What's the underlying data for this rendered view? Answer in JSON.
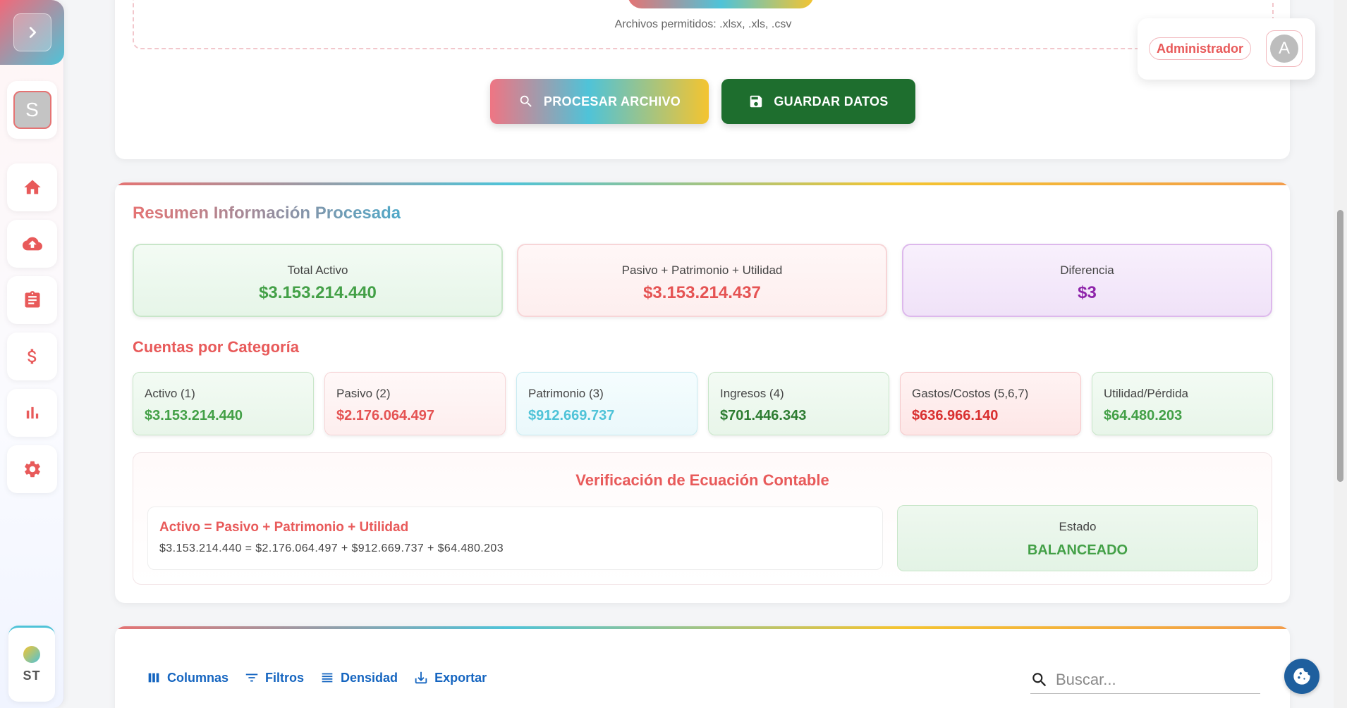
{
  "sidebar": {
    "toggle_icon": "chevron-right-icon",
    "user_initial": "S",
    "nav": [
      {
        "icon": "home-icon"
      },
      {
        "icon": "cloud-upload-icon"
      },
      {
        "icon": "clipboard-icon"
      },
      {
        "icon": "dollar-icon"
      },
      {
        "icon": "bar-chart-icon"
      },
      {
        "icon": "gear-icon"
      }
    ],
    "theme_label": "ST"
  },
  "upload": {
    "allowed_text": "Archivos permitidos: .xlsx, .xls, .csv",
    "process_label": "PROCESAR ARCHIVO",
    "save_label": "GUARDAR DATOS"
  },
  "user": {
    "role": "Administrador",
    "initial": "A"
  },
  "summary": {
    "title": "Resumen Información Procesada",
    "total_activo_label": "Total Activo",
    "total_activo_value": "$3.153.214.440",
    "pasivo_label": "Pasivo + Patrimonio + Utilidad",
    "pasivo_value": "$3.153.214.437",
    "diferencia_label": "Diferencia",
    "diferencia_value": "$3",
    "categories_title": "Cuentas por Categoría",
    "categories": [
      {
        "label": "Activo (1)",
        "value": "$3.153.214.440"
      },
      {
        "label": "Pasivo (2)",
        "value": "$2.176.064.497"
      },
      {
        "label": "Patrimonio (3)",
        "value": "$912.669.737"
      },
      {
        "label": "Ingresos (4)",
        "value": "$701.446.343"
      },
      {
        "label": "Gastos/Costos (5,6,7)",
        "value": "$636.966.140"
      },
      {
        "label": "Utilidad/Pérdida",
        "value": "$64.480.203"
      }
    ],
    "verification_title": "Verificación de Ecuación Contable",
    "equation_title": "Activo = Pasivo + Patrimonio + Utilidad",
    "equation_line": "$3.153.214.440 = $2.176.064.497 + $912.669.737 + $64.480.203",
    "estado_label": "Estado",
    "estado_value": "BALANCEADO"
  },
  "table_toolbar": {
    "columns_label": "Columnas",
    "filters_label": "Filtros",
    "density_label": "Densidad",
    "export_label": "Exportar",
    "search_placeholder": "Buscar..."
  },
  "colors": {
    "accent_red": "#e85a5a",
    "accent_cyan": "#4fc3d8",
    "accent_yellow": "#f4c430",
    "save_green": "#1e6e2e",
    "link_blue": "#1565c0"
  }
}
